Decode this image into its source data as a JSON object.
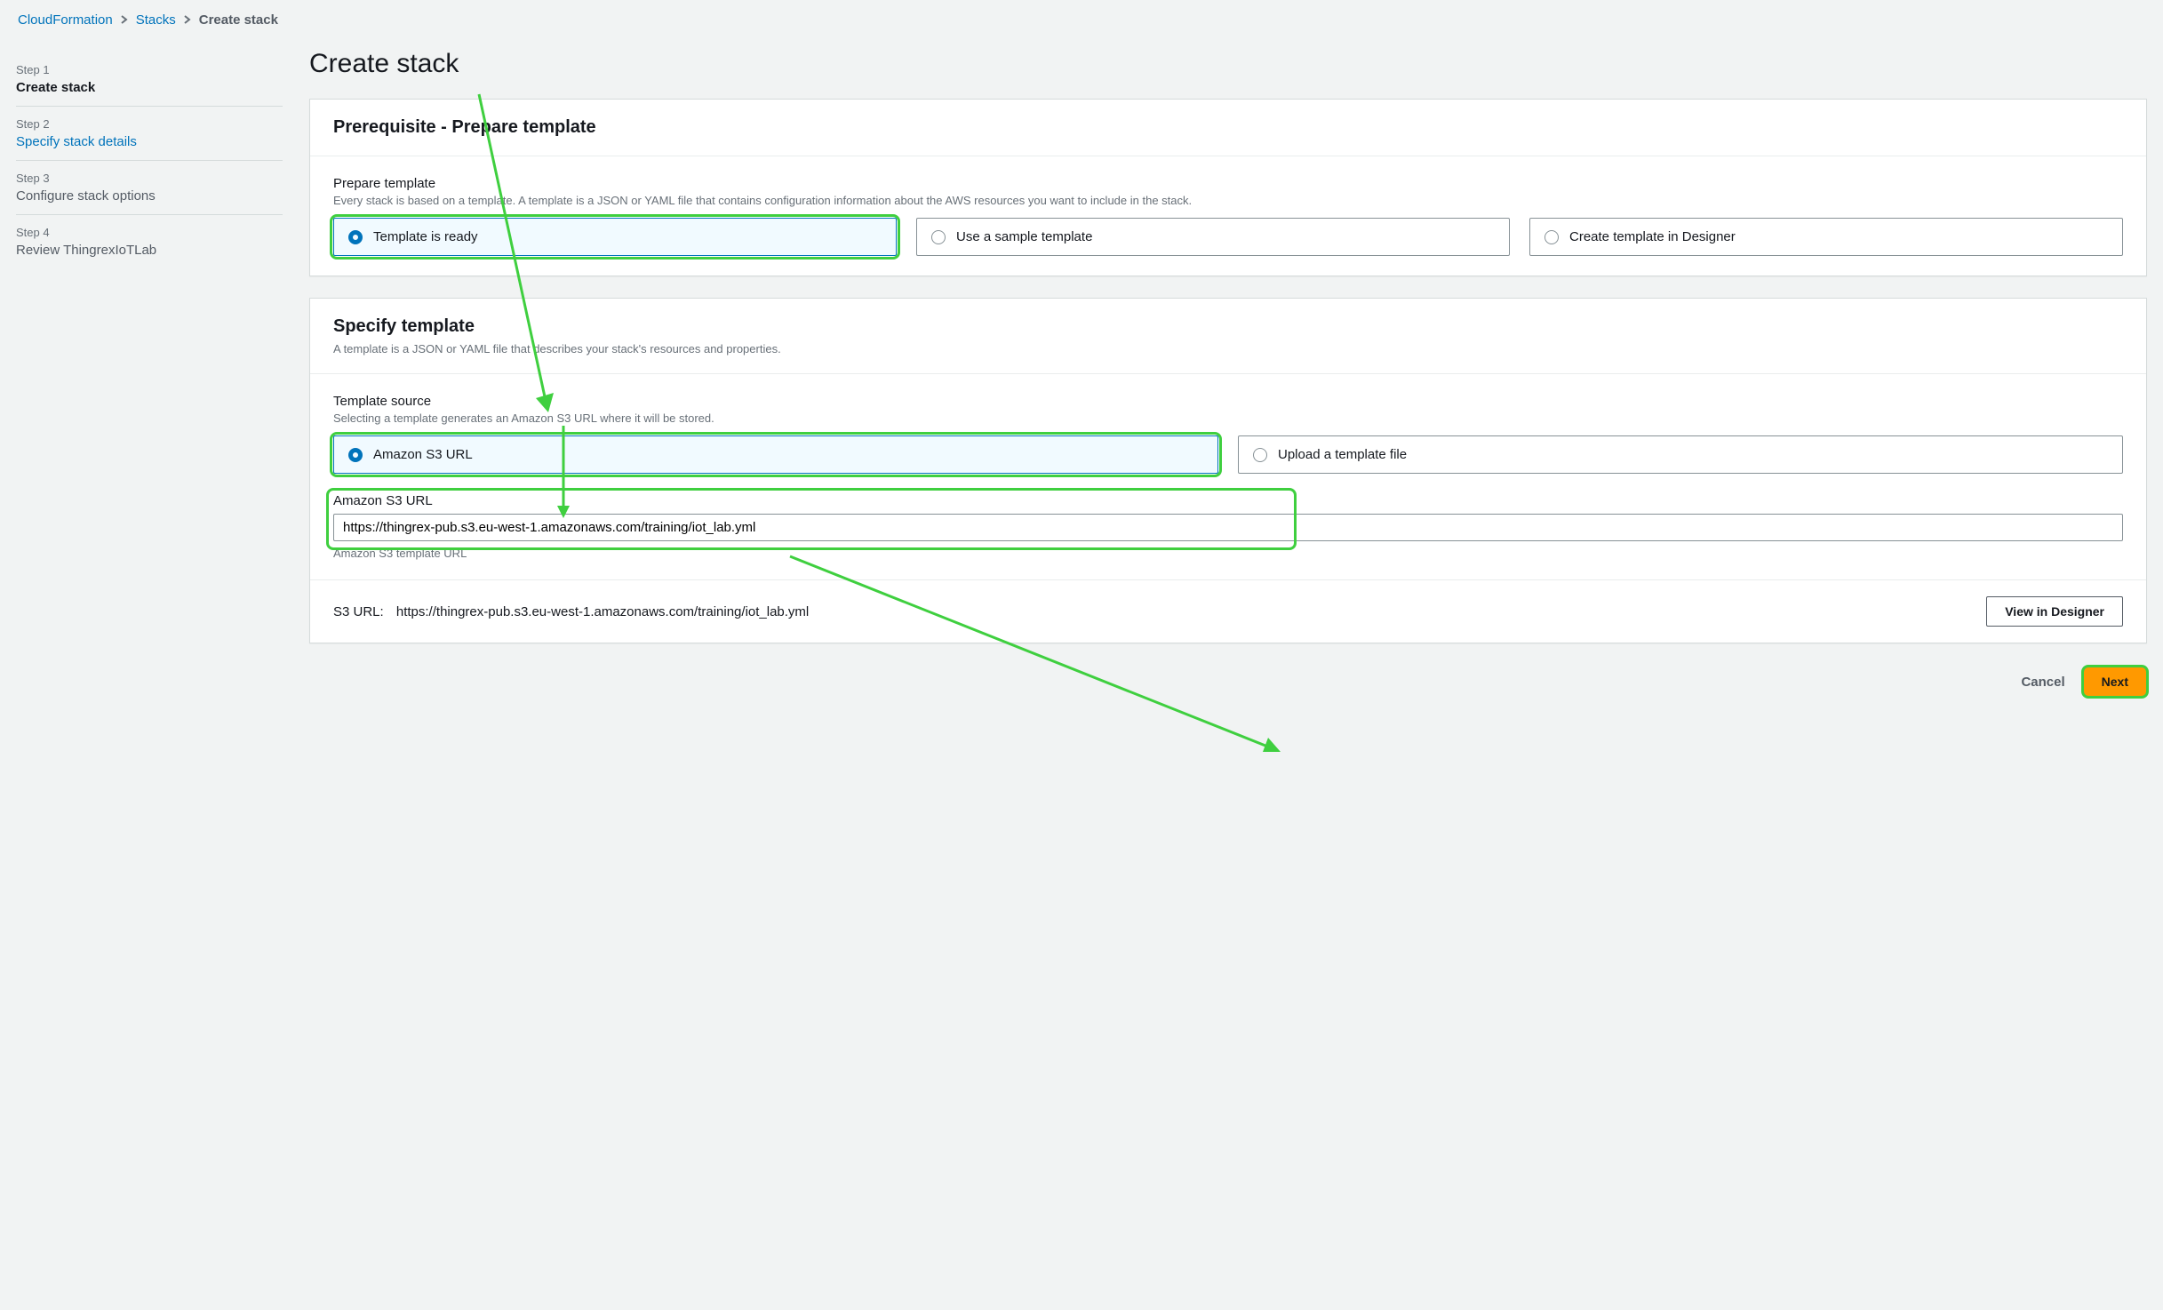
{
  "breadcrumbs": {
    "items": [
      "CloudFormation",
      "Stacks",
      "Create stack"
    ]
  },
  "steps": [
    {
      "label": "Step 1",
      "title": "Create stack",
      "active": true,
      "link": false
    },
    {
      "label": "Step 2",
      "title": "Specify stack details",
      "active": false,
      "link": true
    },
    {
      "label": "Step 3",
      "title": "Configure stack options",
      "active": false,
      "link": false
    },
    {
      "label": "Step 4",
      "title": "Review ThingrexIoTLab",
      "active": false,
      "link": false
    }
  ],
  "page": {
    "title": "Create stack"
  },
  "prereq": {
    "heading": "Prerequisite - Prepare template",
    "field_label": "Prepare template",
    "field_help": "Every stack is based on a template. A template is a JSON or YAML file that contains configuration information about the AWS resources you want to include in the stack.",
    "options": [
      "Template is ready",
      "Use a sample template",
      "Create template in Designer"
    ],
    "selected": 0
  },
  "specify": {
    "heading": "Specify template",
    "sub": "A template is a JSON or YAML file that describes your stack's resources and properties.",
    "source_label": "Template source",
    "source_help": "Selecting a template generates an Amazon S3 URL where it will be stored.",
    "source_options": [
      "Amazon S3 URL",
      "Upload a template file"
    ],
    "source_selected": 0,
    "url_label": "Amazon S3 URL",
    "url_value": "https://thingrex-pub.s3.eu-west-1.amazonaws.com/training/iot_lab.yml",
    "url_caption": "Amazon S3 template URL",
    "s3_display_label": "S3 URL:",
    "s3_display_value": "https://thingrex-pub.s3.eu-west-1.amazonaws.com/training/iot_lab.yml",
    "view_designer": "View in Designer"
  },
  "actions": {
    "cancel": "Cancel",
    "next": "Next"
  }
}
